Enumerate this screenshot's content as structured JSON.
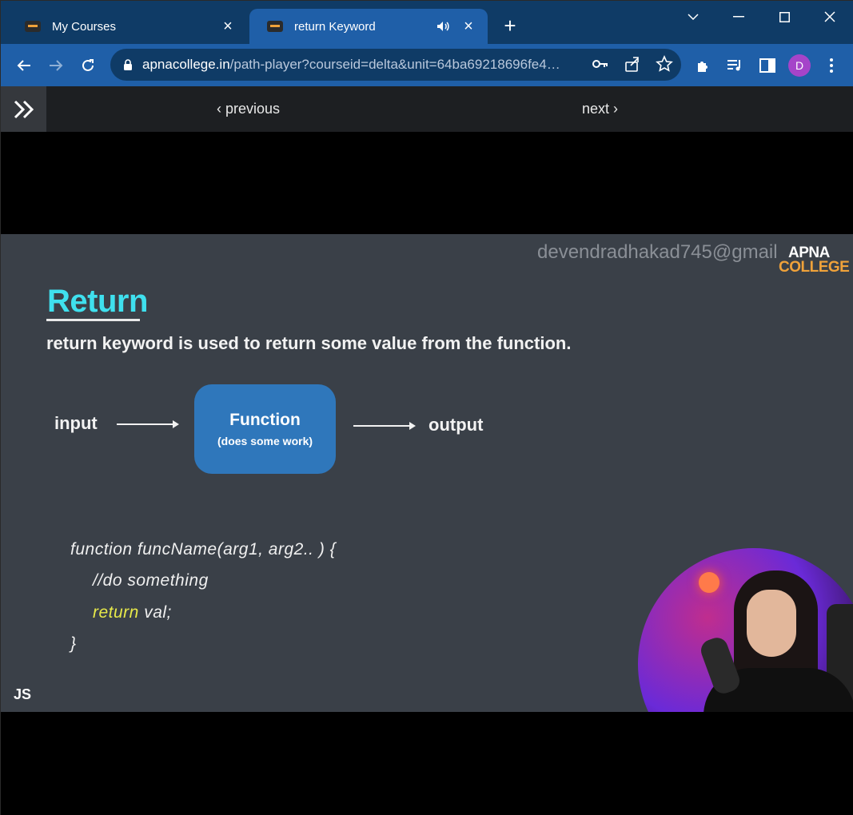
{
  "browser": {
    "tabs": [
      {
        "title": "My Courses",
        "favicon": "apna-college-favicon",
        "close_icon": "×"
      },
      {
        "title": "return Keyword",
        "favicon": "apna-college-favicon",
        "close_icon": "×",
        "audio_icon": "speaker-icon"
      }
    ],
    "new_tab_icon": "+",
    "url_domain": "apnacollege.in",
    "url_rest": "/path-player?courseid=delta&unit=64ba69218696fe4…",
    "avatar_letter": "D",
    "accent": "#1f5fa8"
  },
  "course_nav": {
    "previous_label": "previous",
    "next_label": "next"
  },
  "slide": {
    "watermark": "devendradhakad745@gmail",
    "logo_line1": "APNA",
    "logo_line2": "COLLEGE",
    "title": "Return",
    "subtitle": "return keyword is used to return some value from the function.",
    "diagram": {
      "input": "input",
      "function_title": "Function",
      "function_sub": "(does some work)",
      "output": "output"
    },
    "code": {
      "line1": "function funcName(arg1, arg2.. ) {",
      "line2": "//do something",
      "line3_kw": "return",
      "line3_rest": " val;",
      "line4": "}"
    },
    "js_label": "JS",
    "title_color": "#3fe0ee",
    "keyword_color": "#e7e94a"
  },
  "player": {
    "progress": 0.004
  }
}
